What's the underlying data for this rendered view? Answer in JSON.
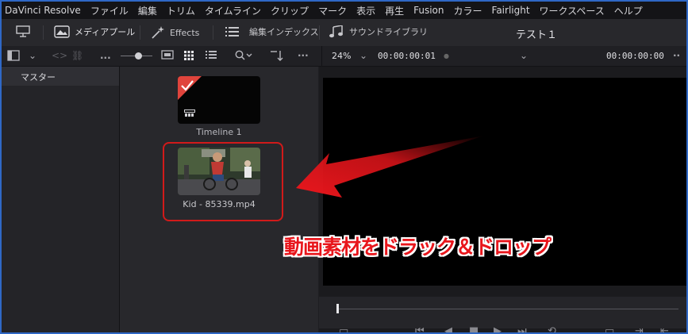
{
  "menubar": {
    "items": [
      "DaVinci Resolve",
      "ファイル",
      "編集",
      "トリム",
      "タイムライン",
      "クリップ",
      "マーク",
      "表示",
      "再生",
      "Fusion",
      "カラー",
      "Fairlight",
      "ワークスペース",
      "ヘルプ"
    ]
  },
  "toolbar": {
    "media_pool": "メディアプール",
    "effects": "Effects",
    "edit_index": "編集インデックス",
    "sound_library": "サウンドライブラリ",
    "project_title": "テスト１"
  },
  "subbar": {
    "more_label": "...",
    "zoom": "24%",
    "timecode_in": "00:00:00:01",
    "timecode_out": "00:00:00:00"
  },
  "bins": {
    "master": "マスター"
  },
  "clips": [
    {
      "name": "Timeline 1"
    },
    {
      "name": "Kid - 85339.mp4"
    }
  ],
  "annotation": {
    "caption": "動画素材をドラック＆ドロップ"
  },
  "colors": {
    "accent_red": "#e8161c",
    "frame_border": "#2f68c6"
  }
}
